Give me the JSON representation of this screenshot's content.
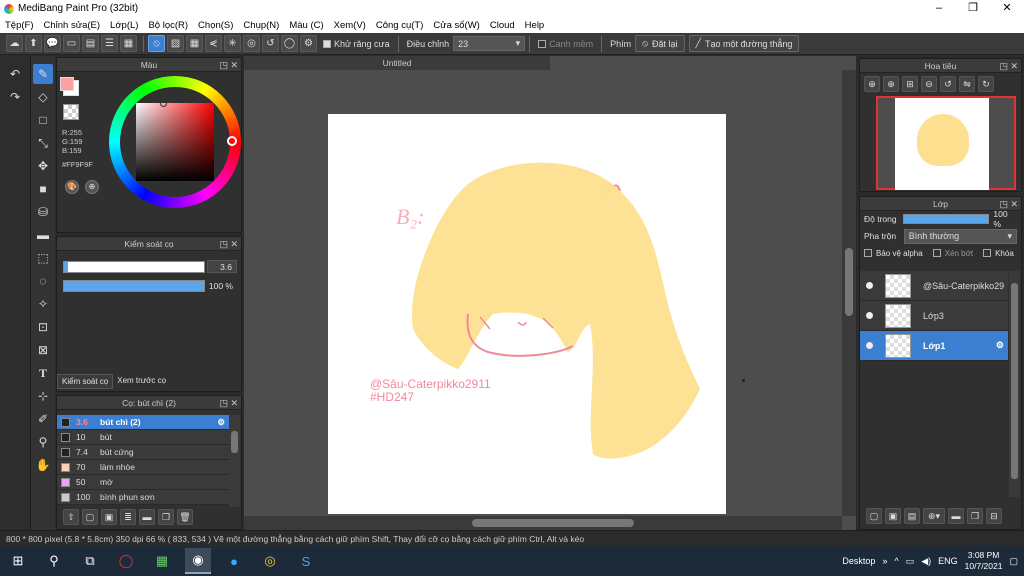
{
  "window": {
    "title": "MediBang Paint Pro (32bit)",
    "min": "–",
    "max": "❐",
    "close": "✕"
  },
  "menu": [
    "Tệp(F)",
    "Chỉnh sửa(E)",
    "Lớp(L)",
    "Bộ lọc(R)",
    "Chọn(S)",
    "Chụp(N)",
    "Màu (C)",
    "Xem(V)",
    "Công cụ(T)",
    "Cửa sổ(W)",
    "Cloud",
    "Help"
  ],
  "toolbar": {
    "antialias_label": "Khử răng cưa",
    "adjust_label": "Điều chỉnh",
    "adjust_value": "23",
    "smooth_label": "Canh mềm",
    "key_label": "Phím",
    "reset_label": "Đặt lại",
    "line_label": "Tạo một đường thẳng"
  },
  "color_panel": {
    "title": "Màu",
    "r": "R:255",
    "g": "G:159",
    "b": "B:159",
    "hex": "#FF9F9F",
    "primary_color": "#FF9F9F",
    "secondary_color": "#FFFFFF"
  },
  "brush_control": {
    "title": "Kiểm soát cọ",
    "size_value": "3.6",
    "size_fraction": 0.03,
    "opacity_value": "100 %",
    "opacity_fraction": 1.0,
    "tab1": "Kiểm soát cọ",
    "tab2": "Xem trước cọ"
  },
  "brush_list": {
    "title": "Cọ: bút chì (2)",
    "items": [
      {
        "size": "3.6",
        "name": "bút chì (2)",
        "color": "#222222",
        "selected": true
      },
      {
        "size": "10",
        "name": "bút",
        "color": "#222222",
        "selected": false
      },
      {
        "size": "7.4",
        "name": "bút cứng",
        "color": "#222222",
        "selected": false
      },
      {
        "size": "70",
        "name": "làm nhòe",
        "color": "#f6d3b8",
        "selected": false
      },
      {
        "size": "50",
        "name": "mờ",
        "color": "#f0a0f0",
        "selected": false
      },
      {
        "size": "100",
        "name": "bình phun sơn",
        "color": "#cccccc",
        "selected": false
      }
    ]
  },
  "document": {
    "tab": "Untitled",
    "signature_line1": "@Sâu-Caterpikko2911",
    "signature_line2": "#HD247"
  },
  "navigator": {
    "title": "Hoa tiêu"
  },
  "layers": {
    "title": "Lớp",
    "opacity_label": "Độ trong",
    "opacity_value": "100 %",
    "blend_label": "Pha trộn",
    "blend_value": "Bình thường",
    "protect_alpha": "Bảo vệ alpha",
    "clipping": "Xén bớt",
    "lock": "Khóa",
    "items": [
      {
        "name": "@Sâu-Caterpikko29",
        "selected": false
      },
      {
        "name": "Lớp3",
        "selected": false
      },
      {
        "name": "Lớp1",
        "selected": true
      }
    ]
  },
  "status": {
    "text": "800 * 800 pixel  (5.8 * 5.8cm)  350 dpi  66 %  ( 833, 534 )  Vẽ một đường thẳng bằng cách giữ phím Shift, Thay đổi cỡ cọ bằng cách giữ phím Ctrl, Alt và kéo"
  },
  "taskbar": {
    "desktop": "Desktop",
    "lang": "ENG",
    "time": "3:08 PM",
    "date": "10/7/2021"
  },
  "colors": {
    "accent": "#3c7fd0",
    "hair": "#fde08f",
    "sketch": "#f08a9a"
  }
}
